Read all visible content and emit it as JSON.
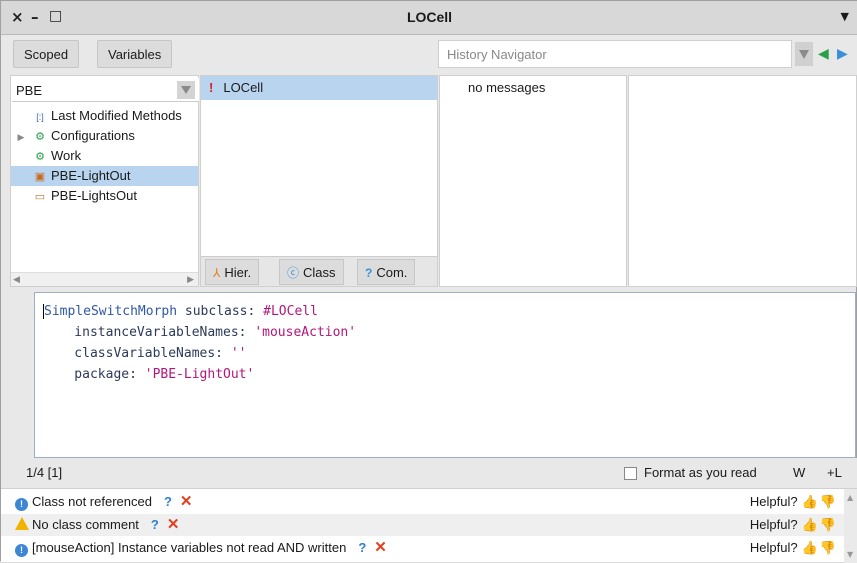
{
  "window": {
    "title": "LOCell",
    "close_glyph": "×",
    "minimize_glyph": "–",
    "maximize_glyph": "□",
    "menu_glyph": "▼"
  },
  "toolbar": {
    "scoped_label": "Scoped",
    "variables_label": "Variables",
    "history_placeholder": "History Navigator",
    "back_glyph": "◀",
    "forward_glyph": "▶"
  },
  "packages": {
    "filter_value": "PBE",
    "items": [
      {
        "icon": "last-modified-icon",
        "glyph": "[:]",
        "label": "Last Modified Methods",
        "expand": ""
      },
      {
        "icon": "configurations-icon",
        "glyph": "⚙",
        "label": "Configurations",
        "expand": "▶"
      },
      {
        "icon": "work-icon",
        "glyph": "⚙",
        "label": "Work",
        "expand": ""
      },
      {
        "icon": "package-icon",
        "glyph": "▣",
        "label": "PBE-LightOut",
        "expand": "",
        "selected": true
      },
      {
        "icon": "package-icon",
        "glyph": "▭",
        "label": "PBE-LightsOut",
        "expand": ""
      }
    ]
  },
  "classes": {
    "items": [
      {
        "flag": "!",
        "label": "LOCell"
      }
    ],
    "tabs": {
      "hier_label": "Hier.",
      "class_label": "Class",
      "comment_label": "Com."
    }
  },
  "protocols": {
    "empty_text": "no messages"
  },
  "editor": {
    "lines": [
      [
        "SimpleSwitchMorph",
        " subclass: ",
        "#LOCell"
      ],
      [
        "    instanceVariableNames: ",
        "'mouseAction'"
      ],
      [
        "    classVariableNames: ",
        "''"
      ],
      [
        "    package: ",
        "'PBE-LightOut'"
      ]
    ]
  },
  "status": {
    "position": "1/4 [1]",
    "format_label": "Format as you read",
    "w_label": "W",
    "l_label": "+L"
  },
  "critics": [
    {
      "icon": "info-icon",
      "text": "Class not referenced",
      "helpful": "Helpful?"
    },
    {
      "icon": "warning-icon",
      "text": "No class comment",
      "helpful": "Helpful?"
    },
    {
      "icon": "info-icon",
      "text": "[mouseAction] Instance variables not read AND written",
      "helpful": "Helpful?"
    }
  ],
  "colors": {
    "selection": "#b8d4ef",
    "keyword_class": "#2f58a6",
    "string": "#b3167a",
    "arrow_green": "#2aa04a",
    "arrow_blue": "#3a8fd9"
  }
}
